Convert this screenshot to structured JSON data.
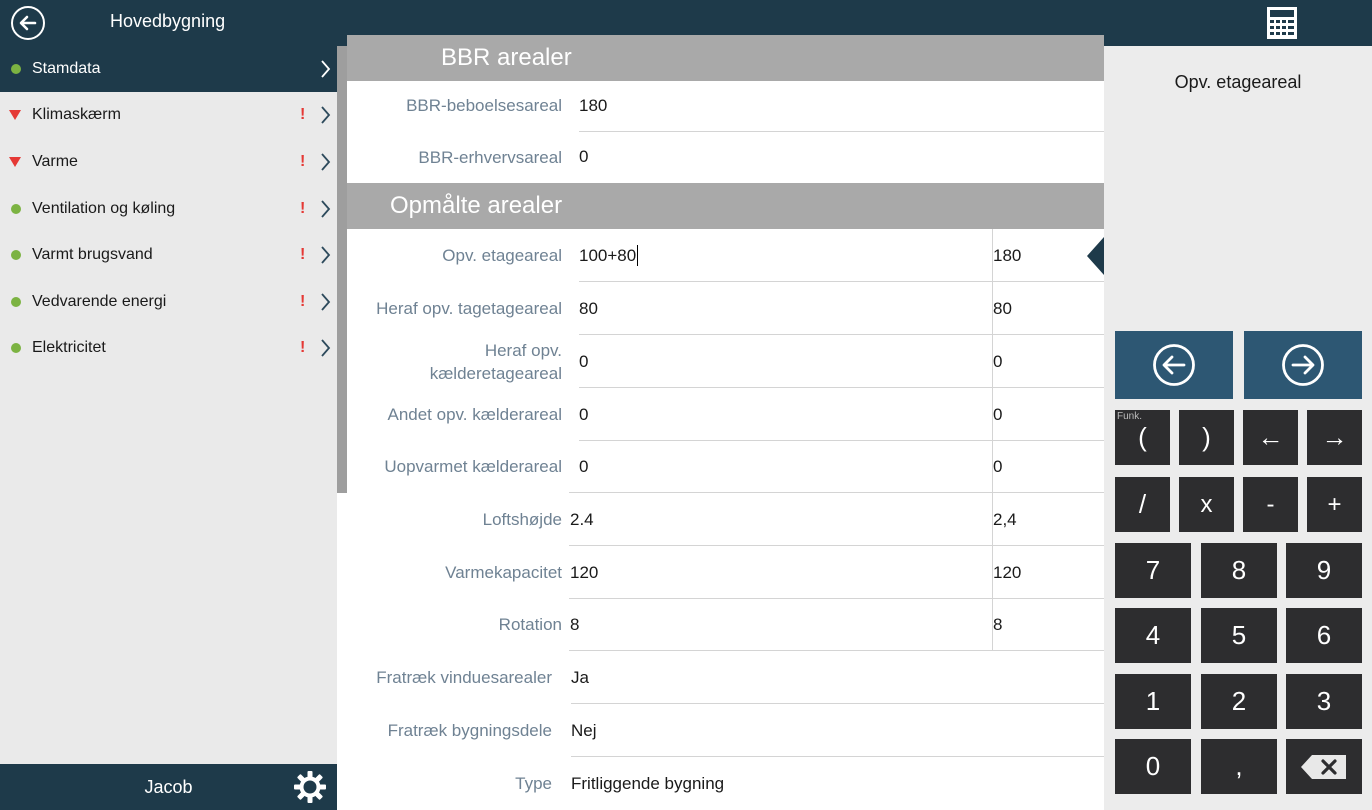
{
  "window": {
    "title": "Hovedbygning",
    "back_icon": "back-arrow-icon",
    "calculator_icon": "calculator-icon"
  },
  "sidebar": {
    "items": [
      {
        "label": "Stamdata",
        "status": "ok",
        "warning": false,
        "active": true
      },
      {
        "label": "Klimaskærm",
        "status": "error",
        "warning": true,
        "active": false
      },
      {
        "label": "Varme",
        "status": "error",
        "warning": true,
        "active": false
      },
      {
        "label": "Ventilation og køling",
        "status": "ok",
        "warning": true,
        "active": false
      },
      {
        "label": "Varmt brugsvand",
        "status": "ok",
        "warning": true,
        "active": false
      },
      {
        "label": "Vedvarende energi",
        "status": "ok",
        "warning": true,
        "active": false
      },
      {
        "label": "Elektricitet",
        "status": "ok",
        "warning": true,
        "active": false
      }
    ],
    "warning_mark": "!",
    "user": "Jacob",
    "settings_icon": "gear-icon"
  },
  "main": {
    "sections": {
      "bbr": "BBR arealer",
      "measured": "Opmålte arealer"
    },
    "bbr_rows": [
      {
        "label": "BBR-beboelsesareal",
        "value": "180"
      },
      {
        "label": "BBR-erhvervsareal",
        "value": "0"
      }
    ],
    "measured_rows": [
      {
        "label": "Opv. etageareal",
        "input": "100+80",
        "result": "180",
        "focused": true
      },
      {
        "label": "Heraf opv. tagetageareal",
        "input": "80",
        "result": "80"
      },
      {
        "label": "Heraf opv. kælderetageareal",
        "label_line1": "Heraf opv.",
        "label_line2": "kælderetageareal",
        "input": "0",
        "result": "0"
      },
      {
        "label": "Andet opv. kælderareal",
        "input": "0",
        "result": "0"
      },
      {
        "label": "Uopvarmet kælderareal",
        "input": "0",
        "result": "0"
      },
      {
        "label": "Loftshøjde",
        "input": "2.4",
        "result": "2,4"
      },
      {
        "label": "Varmekapacitet",
        "input": "120",
        "result": "120"
      },
      {
        "label": "Rotation",
        "input": "8",
        "result": "8"
      }
    ],
    "options_rows": [
      {
        "label": "Fratræk vinduesarealer",
        "value": "Ja"
      },
      {
        "label": "Fratræk bygningsdele",
        "value": "Nej"
      },
      {
        "label": "Type",
        "value": "Fritliggende bygning"
      }
    ]
  },
  "keypad": {
    "field_title": "Opv. etageareal",
    "prev_icon": "circle-arrow-left-icon",
    "next_icon": "circle-arrow-right-icon",
    "funk_label": "Funk.",
    "row1": [
      "(",
      ")",
      "←",
      "→"
    ],
    "row2": [
      "/",
      "x",
      "-",
      "+"
    ],
    "digits": [
      "7",
      "8",
      "9",
      "4",
      "5",
      "6",
      "1",
      "2",
      "3",
      "0",
      ","
    ],
    "backspace_icon": "backspace-icon"
  },
  "colors": {
    "header": "#1e3a4a",
    "accent": "#2d5773",
    "key": "#2d2d2f",
    "ok": "#7cb342",
    "error": "#e53935",
    "section": "#a9a9a9"
  }
}
